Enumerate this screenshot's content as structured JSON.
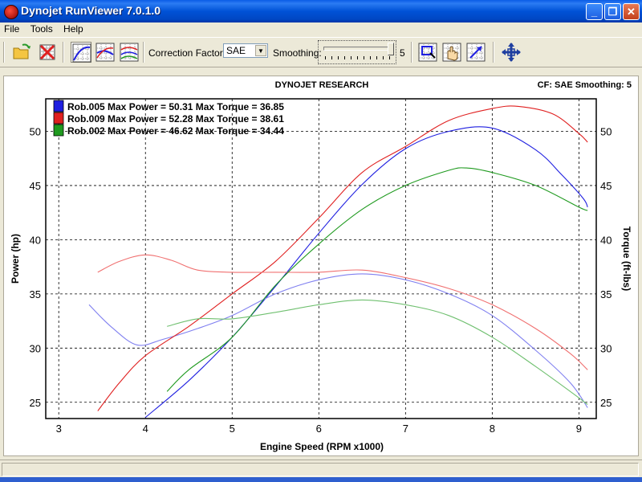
{
  "window": {
    "title": "Dynojet RunViewer 7.0.1.0"
  },
  "menu": {
    "items": [
      "File",
      "Tools",
      "Help"
    ]
  },
  "toolbar": {
    "correction_label": "Correction Factor:",
    "correction_value": "SAE",
    "smoothing_label": "Smoothing:",
    "smoothing_value": "5",
    "smoothing_level": 5,
    "smoothing_max": 5
  },
  "header": {
    "center": "DYNOJET RESEARCH",
    "right": "CF: SAE  Smoothing: 5"
  },
  "chart_data": {
    "type": "line",
    "xlabel": "Engine Speed (RPM x1000)",
    "ylabel_left": "Power (hp)",
    "ylabel_right": "Torque (ft-lbs)",
    "xlim": [
      2.85,
      9.2
    ],
    "ylim": [
      23.5,
      53
    ],
    "x_ticks": [
      "3",
      "4",
      "5",
      "6",
      "7",
      "8",
      "9"
    ],
    "y_ticks_left": [
      "25",
      "30",
      "35",
      "40",
      "45",
      "50"
    ],
    "y_ticks_right": [
      "25",
      "30",
      "35",
      "40",
      "45",
      "50"
    ],
    "grid": true,
    "legend_position": "top-left",
    "legend": [
      {
        "label": "Rob.005 Max Power = 50.31 Max Torque = 36.85",
        "color": "#1f1fe0"
      },
      {
        "label": "Rob.009 Max Power = 52.28 Max Torque = 38.61",
        "color": "#e02020"
      },
      {
        "label": "Rob.002 Max Power = 46.62 Max Torque = 34.44",
        "color": "#1f9a1f"
      }
    ],
    "series": [
      {
        "name": "Rob.005 power",
        "color": "#1f1fe0",
        "points": [
          [
            4.0,
            23.6
          ],
          [
            4.5,
            27.0
          ],
          [
            5.0,
            31.0
          ],
          [
            5.5,
            35.7
          ],
          [
            6.0,
            40.6
          ],
          [
            6.5,
            45.1
          ],
          [
            7.0,
            48.4
          ],
          [
            7.5,
            50.0
          ],
          [
            8.0,
            50.3
          ],
          [
            8.5,
            48.3
          ],
          [
            8.8,
            46.0
          ],
          [
            9.05,
            43.8
          ],
          [
            9.1,
            43.0
          ]
        ]
      },
      {
        "name": "Rob.005 torque",
        "color": "#8080f0",
        "points": [
          [
            3.35,
            34.0
          ],
          [
            3.6,
            32.0
          ],
          [
            3.9,
            30.3
          ],
          [
            4.2,
            30.8
          ],
          [
            4.6,
            31.8
          ],
          [
            5.0,
            33.0
          ],
          [
            5.5,
            35.0
          ],
          [
            6.0,
            36.3
          ],
          [
            6.5,
            36.85
          ],
          [
            7.0,
            36.3
          ],
          [
            7.5,
            35.0
          ],
          [
            8.0,
            33.0
          ],
          [
            8.5,
            29.8
          ],
          [
            8.9,
            26.8
          ],
          [
            9.1,
            24.5
          ]
        ]
      },
      {
        "name": "Rob.009 power",
        "color": "#e02020",
        "points": [
          [
            3.45,
            24.2
          ],
          [
            3.7,
            26.8
          ],
          [
            4.0,
            29.3
          ],
          [
            4.5,
            32.0
          ],
          [
            5.0,
            35.0
          ],
          [
            5.5,
            38.0
          ],
          [
            6.0,
            42.0
          ],
          [
            6.5,
            46.2
          ],
          [
            7.0,
            48.6
          ],
          [
            7.5,
            51.0
          ],
          [
            8.0,
            52.1
          ],
          [
            8.3,
            52.3
          ],
          [
            8.7,
            51.6
          ],
          [
            9.0,
            49.8
          ],
          [
            9.1,
            49.0
          ]
        ]
      },
      {
        "name": "Rob.009 torque",
        "color": "#f07070",
        "points": [
          [
            3.45,
            37.0
          ],
          [
            3.7,
            38.0
          ],
          [
            4.0,
            38.6
          ],
          [
            4.3,
            38.1
          ],
          [
            4.6,
            37.2
          ],
          [
            5.0,
            37.0
          ],
          [
            5.5,
            37.0
          ],
          [
            6.0,
            37.0
          ],
          [
            6.5,
            37.2
          ],
          [
            7.0,
            36.5
          ],
          [
            7.5,
            35.5
          ],
          [
            8.0,
            34.0
          ],
          [
            8.5,
            31.8
          ],
          [
            8.9,
            29.5
          ],
          [
            9.1,
            28.0
          ]
        ]
      },
      {
        "name": "Rob.002 power",
        "color": "#1f9a1f",
        "points": [
          [
            4.25,
            26.0
          ],
          [
            4.5,
            28.0
          ],
          [
            5.0,
            31.0
          ],
          [
            5.5,
            35.8
          ],
          [
            6.0,
            39.6
          ],
          [
            6.5,
            42.8
          ],
          [
            7.0,
            45.0
          ],
          [
            7.5,
            46.4
          ],
          [
            7.7,
            46.62
          ],
          [
            8.0,
            46.2
          ],
          [
            8.5,
            45.0
          ],
          [
            9.0,
            43.0
          ],
          [
            9.1,
            42.7
          ]
        ]
      },
      {
        "name": "Rob.002 torque",
        "color": "#70c070",
        "points": [
          [
            4.25,
            32.0
          ],
          [
            4.6,
            32.7
          ],
          [
            5.0,
            32.7
          ],
          [
            5.5,
            33.3
          ],
          [
            6.0,
            34.0
          ],
          [
            6.5,
            34.44
          ],
          [
            7.0,
            34.0
          ],
          [
            7.5,
            33.0
          ],
          [
            8.0,
            31.0
          ],
          [
            8.5,
            28.3
          ],
          [
            8.9,
            26.0
          ],
          [
            9.1,
            24.8
          ]
        ]
      }
    ]
  }
}
